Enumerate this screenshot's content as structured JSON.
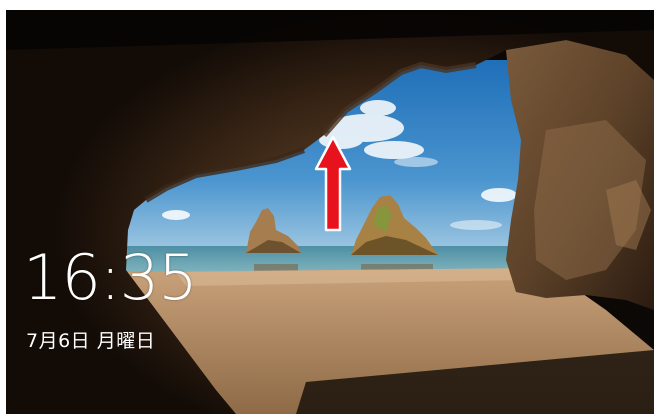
{
  "lock_screen": {
    "time": "16:35",
    "date": "7月6日 月曜日"
  },
  "hint": {
    "icon": "arrow-up-icon",
    "color": "#e8121c"
  },
  "colors": {
    "sky": "#3a86c8",
    "sea": "#5fa7b6",
    "sand": "#b89066",
    "rock": "#3b2618",
    "text": "#ffffff"
  }
}
